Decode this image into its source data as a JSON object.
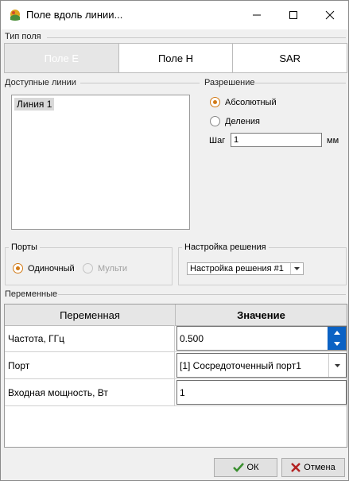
{
  "window": {
    "title": "Поле вдоль линии..."
  },
  "field_type": {
    "label": "Тип поля",
    "tabs": [
      "Поле E",
      "Поле H",
      "SAR"
    ],
    "selected": 0
  },
  "lines": {
    "label": "Доступные линии",
    "items": [
      "Линия 1"
    ]
  },
  "resolution": {
    "label": "Разрешение",
    "options": [
      "Абсолютный",
      "Деления"
    ],
    "selected": 0,
    "step_label": "Шаг",
    "step_value": "1",
    "unit": "мм"
  },
  "ports": {
    "label": "Порты",
    "options": [
      "Одиночный",
      "Мульти"
    ],
    "selected": 0
  },
  "solution": {
    "label": "Настройка решения",
    "value": "Настройка решения #1"
  },
  "variables": {
    "label": "Переменные",
    "columns": [
      "Переменная",
      "Значение"
    ],
    "rows": [
      {
        "name": "Частота, ГГц",
        "value": "0.500"
      },
      {
        "name": "Порт",
        "value": "[1] Сосредоточенный порт1"
      },
      {
        "name": "Входная мощность, Вт",
        "value": "1"
      }
    ]
  },
  "buttons": {
    "ok": "ОК",
    "cancel": "Отмена"
  },
  "colors": {
    "accent_radio": "#d27a16",
    "spin_blue": "#0b62c4"
  }
}
